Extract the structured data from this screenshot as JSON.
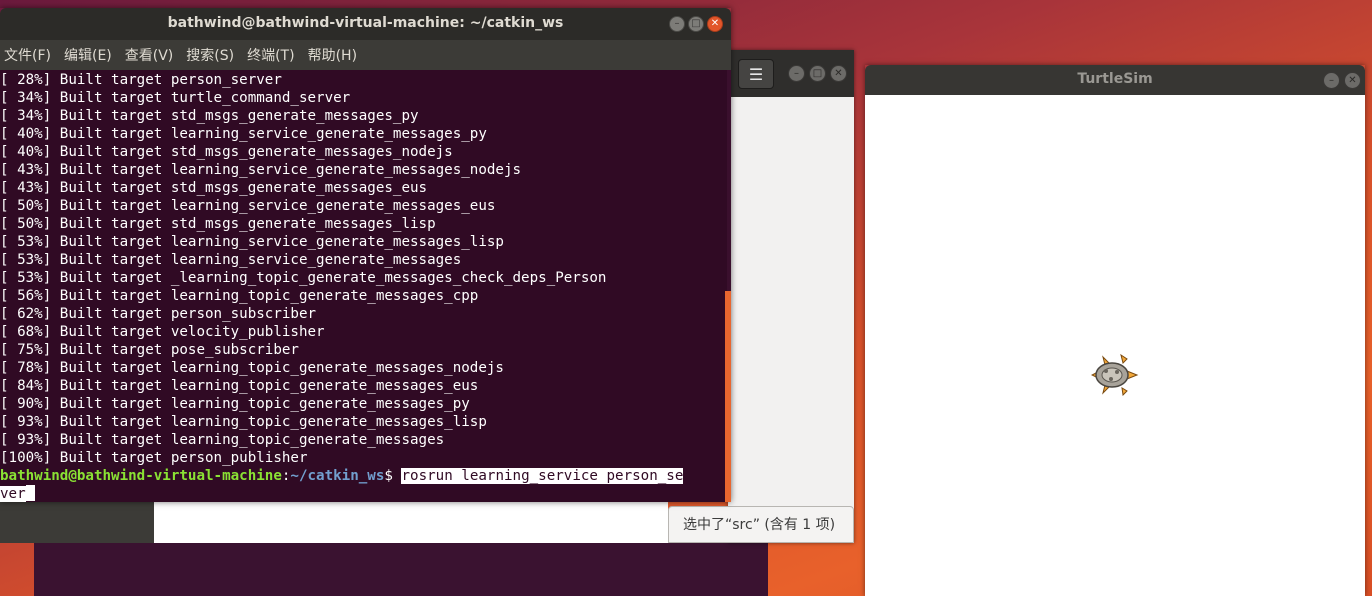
{
  "terminal": {
    "title": "bathwind@bathwind-virtual-machine: ~/catkin_ws",
    "menu": [
      "文件(F)",
      "编辑(E)",
      "查看(V)",
      "搜索(S)",
      "终端(T)",
      "帮助(H)"
    ],
    "lines": [
      "[ 28%] Built target person_server",
      "[ 34%] Built target turtle_command_server",
      "[ 34%] Built target std_msgs_generate_messages_py",
      "[ 40%] Built target learning_service_generate_messages_py",
      "[ 40%] Built target std_msgs_generate_messages_nodejs",
      "[ 43%] Built target learning_service_generate_messages_nodejs",
      "[ 43%] Built target std_msgs_generate_messages_eus",
      "[ 50%] Built target learning_service_generate_messages_eus",
      "[ 50%] Built target std_msgs_generate_messages_lisp",
      "[ 53%] Built target learning_service_generate_messages_lisp",
      "[ 53%] Built target learning_service_generate_messages",
      "[ 53%] Built target _learning_topic_generate_messages_check_deps_Person",
      "[ 56%] Built target learning_topic_generate_messages_cpp",
      "[ 62%] Built target person_subscriber",
      "[ 68%] Built target velocity_publisher",
      "[ 75%] Built target pose_subscriber",
      "[ 78%] Built target learning_topic_generate_messages_nodejs",
      "[ 84%] Built target learning_topic_generate_messages_eus",
      "[ 90%] Built target learning_topic_generate_messages_py",
      "[ 93%] Built target learning_topic_generate_messages_lisp",
      "[ 93%] Built target learning_topic_generate_messages",
      "[100%] Built target person_publisher"
    ],
    "prompt_user": "bathwind@bathwind-virtual-machine",
    "prompt_sep": ":",
    "prompt_path": "~/catkin_ws",
    "prompt_dollar": "$ ",
    "command_part1": "rosrun learning_service person_se",
    "command_part2": "ver",
    "minimize_glyph": "–",
    "maximize_glyph": "□",
    "close_glyph": "✕"
  },
  "file_manager": {
    "menu_glyph": "☰",
    "status": "选中了“src” (含有 1 项)"
  },
  "turtlesim": {
    "title": "TurtleSim",
    "minimize_glyph": "–",
    "close_glyph": "✕"
  },
  "colors": {
    "terminal_bg": "#300a24",
    "prompt_user": "#8ae234",
    "prompt_path": "#729fcf",
    "accent_orange": "#e8662f"
  }
}
